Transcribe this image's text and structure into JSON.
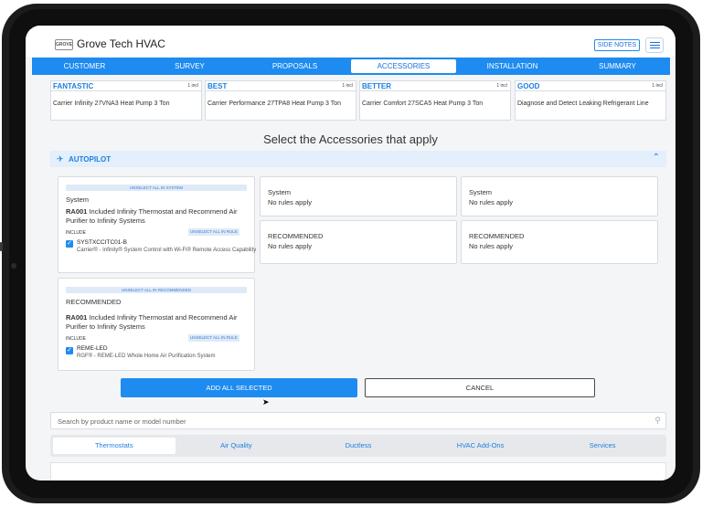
{
  "header": {
    "logo_text": "GROVE",
    "brand": "Grove Tech HVAC",
    "side_notes_label": "SIDE NOTES",
    "menu_icon": "hamburger-icon"
  },
  "nav": {
    "tabs": [
      {
        "label": "CUSTOMER"
      },
      {
        "label": "SURVEY"
      },
      {
        "label": "PROPOSALS"
      },
      {
        "label": "ACCESSORIES",
        "active": true
      },
      {
        "label": "INSTALLATION"
      },
      {
        "label": "SUMMARY"
      }
    ]
  },
  "tiers": [
    {
      "name": "FANTASTIC",
      "count": "1 incl",
      "product": "Carrier Infinity 27VNA3 Heat Pump 3 Ton"
    },
    {
      "name": "BEST",
      "count": "1 incl",
      "product": "Carrier Performance 27TPA8 Heat Pump 3 Ton"
    },
    {
      "name": "BETTER",
      "count": "1 incl",
      "product": "Carrier Comfort 27SCA5 Heat Pump 3 Ton"
    },
    {
      "name": "GOOD",
      "count": "1 incl",
      "product": "Diagnose and Detect Leaking Refrigerant Line"
    }
  ],
  "section_title": "Select the Accessories that apply",
  "autopilot": {
    "label": "AUTOPILOT",
    "icon": "rocket-icon",
    "collapse_icon": "chevron-up-icon"
  },
  "system_card": {
    "unselect_all": "UNSELECT ALL IN SYSTEM",
    "title": "System",
    "rule_code": "RA001",
    "rule_text": "Included Infinity Thermostat and Recommend Air Purifier to Infinity Systems",
    "include_label": "INCLUDE",
    "unselect_rule": "UNSELECT ALL IN RULE",
    "item_code": "SYSTXCCITC01-B",
    "item_desc": "Carrier® - Infinity® System Control with Wi-Fi® Remote Access Capability"
  },
  "recommended_card": {
    "unselect_all": "UNSELECT ALL IN RECOMMENDED",
    "title": "RECOMMENDED",
    "rule_code": "RA001",
    "rule_text": "Included Infinity Thermostat and Recommend Air Purifier to Infinity Systems",
    "include_label": "INCLUDE",
    "unselect_rule": "UNSELECT ALL IN RULE",
    "item_code": "REME-LED",
    "item_desc": "RGF® - REME-LED     Whole Home Air Purification System"
  },
  "rule_cards": [
    {
      "title": "System",
      "text": "No rules apply"
    },
    {
      "title": "System",
      "text": "No rules apply"
    },
    {
      "title": "RECOMMENDED",
      "text": "No rules apply"
    },
    {
      "title": "RECOMMENDED",
      "text": "No rules apply"
    }
  ],
  "buttons": {
    "add_all": "ADD ALL SELECTED",
    "cancel": "CANCEL"
  },
  "search": {
    "placeholder": "Search by product name or model number"
  },
  "categories": [
    {
      "label": "Thermostats",
      "active": true
    },
    {
      "label": "Air Quality"
    },
    {
      "label": "Ductless"
    },
    {
      "label": "HVAC Add-Ons"
    },
    {
      "label": "Services"
    }
  ],
  "colors": {
    "primary": "#1e8bf0",
    "accent_text": "#1e7fe0",
    "autopilot_bg": "#e3effb"
  }
}
